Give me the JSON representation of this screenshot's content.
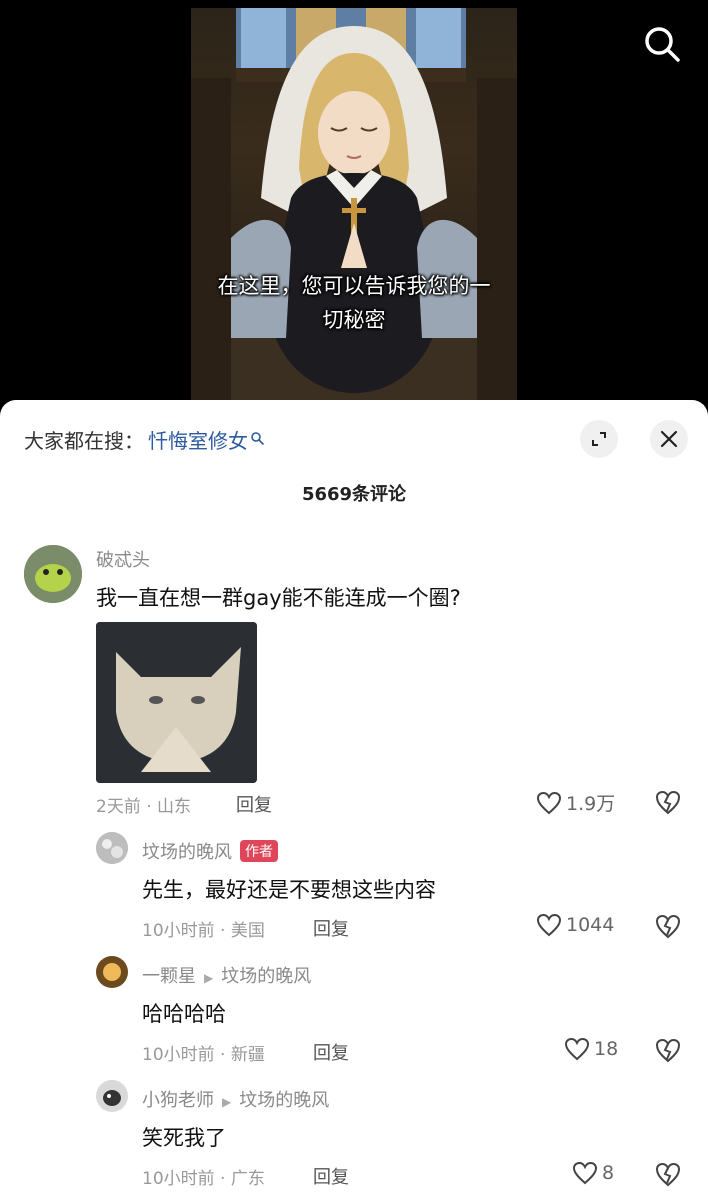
{
  "video": {
    "subtitle_line1": "在这里，您可以告诉我您的一",
    "subtitle_line2": "切秘密"
  },
  "icons": {
    "search": "search-icon",
    "expand": "expand-icon",
    "close": "close-icon",
    "like": "heart-icon",
    "dislike": "broken-heart-icon",
    "reply_arrow": "play-triangle-icon"
  },
  "sheet": {
    "trending_prefix": "大家都在搜：",
    "trending_query": "忏悔室修女",
    "comment_count": "5669条评论"
  },
  "comments": [
    {
      "username": "破忒头",
      "text": "我一直在想一群gay能不能连成一个圈?",
      "meta": "2天前 · 山东",
      "reply_label": "回复",
      "likes": "1.9万"
    },
    {
      "username": "坟场的晚风",
      "badge": "作者",
      "text": "先生，最好还是不要想这些内容",
      "meta": "10小时前 · 美国",
      "reply_label": "回复",
      "likes": "1044"
    },
    {
      "username": "一颗星",
      "reply_to": "坟场的晚风",
      "text": "哈哈哈哈",
      "meta": "10小时前 · 新疆",
      "reply_label": "回复",
      "likes": "18"
    },
    {
      "username": "小狗老师",
      "reply_to": "坟场的晚风",
      "text": "笑死我了",
      "meta": "10小时前 · 广东",
      "reply_label": "回复",
      "likes": "8"
    }
  ],
  "colors": {
    "link_blue": "#2d5ba0",
    "author_badge": "#e0465a",
    "meta_gray": "#999999"
  }
}
